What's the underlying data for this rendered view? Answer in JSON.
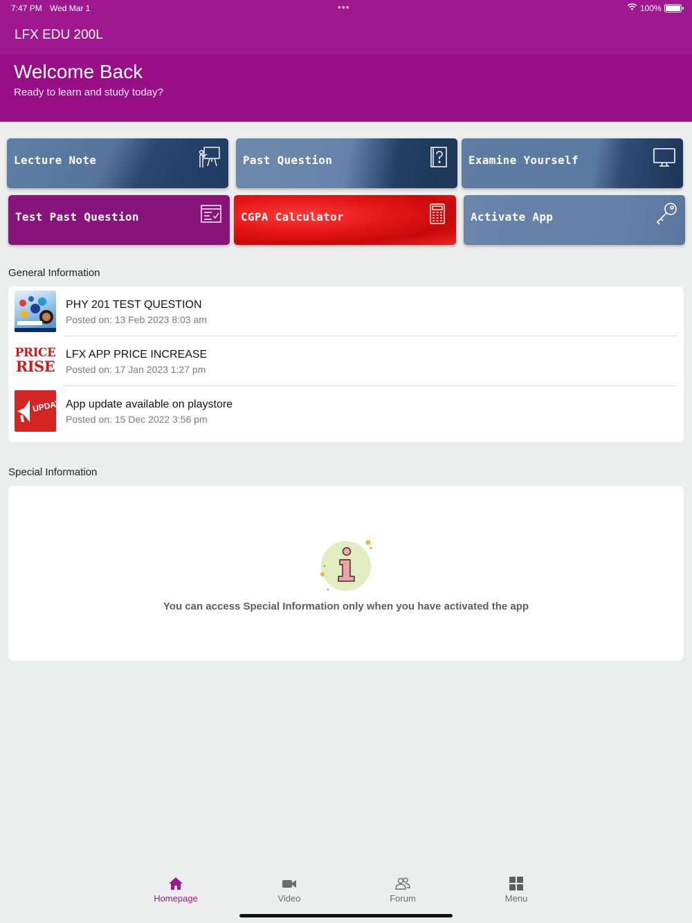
{
  "status_bar": {
    "time": "7:47 PM",
    "date": "Wed Mar 1",
    "dots": "•••",
    "battery": "100%"
  },
  "app_bar": {
    "title": "LFX EDU 200L"
  },
  "hero": {
    "welcome": "Welcome Back",
    "subtitle": "Ready to learn and study today?"
  },
  "tiles": [
    {
      "label": "Lecture Note",
      "icon": "presentation-icon"
    },
    {
      "label": "Past Question",
      "icon": "question-book-icon"
    },
    {
      "label": "Examine Yourself",
      "icon": "monitor-icon"
    },
    {
      "label": "Test Past Question",
      "icon": "checklist-icon"
    },
    {
      "label": "CGPA Calculator",
      "icon": "calculator-icon"
    },
    {
      "label": "Activate App",
      "icon": "key-icon"
    }
  ],
  "general": {
    "title": "General Information",
    "items": [
      {
        "title": "PHY 201 TEST QUESTION",
        "date": "Posted on: 13 Feb 2023 8:03 am"
      },
      {
        "title": "LFX APP PRICE INCREASE",
        "date": "Posted on: 17 Jan 2023 1:27 pm",
        "thumb_text_1": "PRICE",
        "thumb_text_2": "RISE"
      },
      {
        "title": "App update available on playstore",
        "date": "Posted on: 15 Dec 2022 3:56 pm",
        "thumb_text": "UPDAT"
      }
    ]
  },
  "special": {
    "title": "Special Information",
    "message": "You can access Special Information only when you have activated the app"
  },
  "bottom_nav": [
    {
      "label": "Homepage",
      "icon": "home-icon",
      "active": true
    },
    {
      "label": "Video",
      "icon": "video-camera-icon",
      "active": false
    },
    {
      "label": "Forum",
      "icon": "people-icon",
      "active": false
    },
    {
      "label": "Menu",
      "icon": "grid-icon",
      "active": false
    }
  ],
  "colors": {
    "brand": "#a0188f",
    "hero": "#980e86",
    "accent_red": "#e41616",
    "tile_blue": "#5f7fa6"
  }
}
